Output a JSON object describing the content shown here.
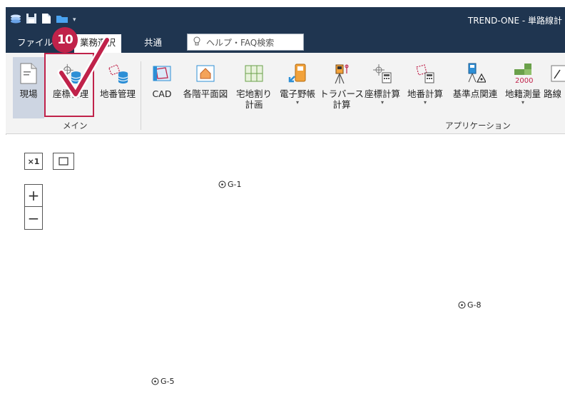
{
  "window": {
    "title": "TREND-ONE - 単路線計"
  },
  "tabs": [
    {
      "label": "ファイル"
    },
    {
      "label": "業務選択"
    },
    {
      "label": "共通"
    }
  ],
  "search": {
    "placeholder": "ヘルプ・FAQ検索"
  },
  "ribbon": {
    "main_buttons": [
      {
        "label": "現場",
        "icon": "document-icon"
      },
      {
        "label": "座標管理",
        "icon": "coordinate-database-icon"
      },
      {
        "label": "地番管理",
        "icon": "parcel-database-icon"
      }
    ],
    "app_buttons": [
      {
        "label": "CAD"
      },
      {
        "label": "各階平面図"
      },
      {
        "label": "宅地割り\n計画"
      },
      {
        "label": "電子野帳"
      },
      {
        "label": "トラバース\n計算"
      },
      {
        "label": "座標計算"
      },
      {
        "label": "地番計算"
      },
      {
        "label": "基準点関連"
      },
      {
        "label": "地籍測量",
        "icon_text": "2000"
      },
      {
        "label": "路線"
      }
    ],
    "groups": {
      "main": "メイン",
      "apps": "アプリケーション"
    }
  },
  "step": {
    "number": "10"
  },
  "canvas": {
    "tools": {
      "fit": "×1",
      "zoom_in": "+",
      "zoom_out": "−"
    },
    "points": [
      {
        "label": "G-1"
      },
      {
        "label": "G-8"
      },
      {
        "label": "G-5"
      }
    ]
  },
  "colors": {
    "title_bar": "#1f3550",
    "highlight": "#c0224a",
    "ribbon_bg": "#f3f3f3",
    "selected": "#cdd5e2"
  }
}
